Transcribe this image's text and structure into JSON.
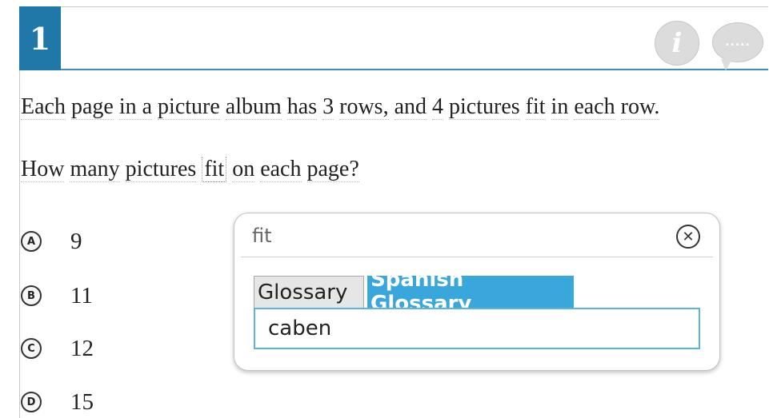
{
  "question": {
    "number": "1",
    "stem_parts": [
      "Each",
      "page",
      "in a",
      "picture",
      "album",
      "has",
      "3",
      "rows,",
      "and",
      "4",
      "pictures",
      "fit",
      "in",
      "each",
      "row."
    ],
    "prompt_parts": [
      "How",
      "many",
      "pictures",
      "fit",
      "on",
      "each",
      "page?"
    ]
  },
  "toolbar": {
    "info_label": "i",
    "comment_label": "....."
  },
  "options": [
    {
      "letter": "A",
      "value": "9"
    },
    {
      "letter": "B",
      "value": "11"
    },
    {
      "letter": "C",
      "value": "12"
    },
    {
      "letter": "D",
      "value": "15"
    }
  ],
  "popup": {
    "title": "fit",
    "close_label": "✕",
    "tabs": [
      {
        "label": "Glossary",
        "active": false
      },
      {
        "label": "Spanish Glossary",
        "active": true
      }
    ],
    "content": "caben"
  },
  "colors": {
    "accent": "#1f78a8",
    "tab_active": "#3aa7dc",
    "content_border": "#5ab3e0"
  },
  "icons": [
    "info-icon",
    "comment-icon",
    "close-icon"
  ]
}
